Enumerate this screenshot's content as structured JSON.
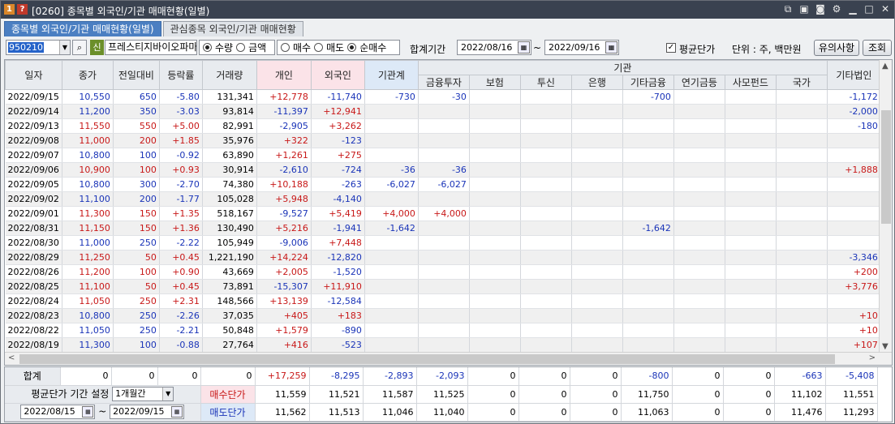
{
  "titlebar": {
    "badge1": "1",
    "badge2": "?",
    "title": "[0260] 종목별 외국인/기관 매매현황(일별)",
    "icons": [
      "link-icon",
      "save-icon",
      "camera-icon",
      "settings-icon",
      "minimize-icon",
      "maximize-icon",
      "close-icon"
    ]
  },
  "tabs": [
    {
      "label": "종목별 외국인/기관 매매현황(일별)",
      "active": true
    },
    {
      "label": "관심종목 외국인/기관 매매현황",
      "active": false
    }
  ],
  "toolbar": {
    "code": "950210",
    "shin": "신",
    "stock_name": "프레스티지바이오파마",
    "unit_type": {
      "options": [
        "수량",
        "금액"
      ],
      "selected": "수량"
    },
    "trade_type": {
      "options": [
        "매수",
        "매도",
        "순매수"
      ],
      "selected": "순매수"
    },
    "period_label": "합계기간",
    "start_date": "2022/08/16",
    "tilde": "~",
    "end_date": "2022/09/16",
    "avg_price_label": "평균단가",
    "avg_price_checked": true,
    "unit_label": "단위 : 주, 백만원",
    "notice_button": "유의사항",
    "query_button": "조회"
  },
  "grid": {
    "group_header": "기관",
    "headers": [
      "일자",
      "종가",
      "전일대비",
      "등락률",
      "거래량",
      "개인",
      "외국인",
      "기관계",
      "금융투자",
      "보험",
      "투신",
      "은행",
      "기타금융",
      "연기금등",
      "사모펀드",
      "국가",
      "기타법인"
    ],
    "rows": [
      {
        "date": "2022/09/15",
        "close": "10,550",
        "chg": "650",
        "rate": "-5.80",
        "vol": "131,341",
        "ind": "+12,778",
        "frn": "-11,740",
        "inst": "-730",
        "fin": "-30",
        "ins": "",
        "trust": "",
        "bank": "",
        "etcfin": "-700",
        "pens": "",
        "pef": "",
        "gov": "",
        "corp": "-1,172",
        "color": "blue",
        "alt": false
      },
      {
        "date": "2022/09/14",
        "close": "11,200",
        "chg": "350",
        "rate": "-3.03",
        "vol": "93,814",
        "ind": "-11,397",
        "frn": "+12,941",
        "inst": "",
        "fin": "",
        "ins": "",
        "trust": "",
        "bank": "",
        "etcfin": "",
        "pens": "",
        "pef": "",
        "gov": "",
        "corp": "-2,000",
        "color": "blue",
        "alt": true
      },
      {
        "date": "2022/09/13",
        "close": "11,550",
        "chg": "550",
        "rate": "+5.00",
        "vol": "82,991",
        "ind": "-2,905",
        "frn": "+3,262",
        "inst": "",
        "fin": "",
        "ins": "",
        "trust": "",
        "bank": "",
        "etcfin": "",
        "pens": "",
        "pef": "",
        "gov": "",
        "corp": "-180",
        "color": "red",
        "alt": false
      },
      {
        "date": "2022/09/08",
        "close": "11,000",
        "chg": "200",
        "rate": "+1.85",
        "vol": "35,976",
        "ind": "+322",
        "frn": "-123",
        "inst": "",
        "fin": "",
        "ins": "",
        "trust": "",
        "bank": "",
        "etcfin": "",
        "pens": "",
        "pef": "",
        "gov": "",
        "corp": "",
        "color": "red",
        "alt": true
      },
      {
        "date": "2022/09/07",
        "close": "10,800",
        "chg": "100",
        "rate": "-0.92",
        "vol": "63,890",
        "ind": "+1,261",
        "frn": "+275",
        "inst": "",
        "fin": "",
        "ins": "",
        "trust": "",
        "bank": "",
        "etcfin": "",
        "pens": "",
        "pef": "",
        "gov": "",
        "corp": "",
        "color": "blue",
        "alt": false
      },
      {
        "date": "2022/09/06",
        "close": "10,900",
        "chg": "100",
        "rate": "+0.93",
        "vol": "30,914",
        "ind": "-2,610",
        "frn": "-724",
        "inst": "-36",
        "fin": "-36",
        "ins": "",
        "trust": "",
        "bank": "",
        "etcfin": "",
        "pens": "",
        "pef": "",
        "gov": "",
        "corp": "+1,888",
        "color": "red",
        "alt": true
      },
      {
        "date": "2022/09/05",
        "close": "10,800",
        "chg": "300",
        "rate": "-2.70",
        "vol": "74,380",
        "ind": "+10,188",
        "frn": "-263",
        "inst": "-6,027",
        "fin": "-6,027",
        "ins": "",
        "trust": "",
        "bank": "",
        "etcfin": "",
        "pens": "",
        "pef": "",
        "gov": "",
        "corp": "",
        "color": "blue",
        "alt": false
      },
      {
        "date": "2022/09/02",
        "close": "11,100",
        "chg": "200",
        "rate": "-1.77",
        "vol": "105,028",
        "ind": "+5,948",
        "frn": "-4,140",
        "inst": "",
        "fin": "",
        "ins": "",
        "trust": "",
        "bank": "",
        "etcfin": "",
        "pens": "",
        "pef": "",
        "gov": "",
        "corp": "",
        "color": "blue",
        "alt": true
      },
      {
        "date": "2022/09/01",
        "close": "11,300",
        "chg": "150",
        "rate": "+1.35",
        "vol": "518,167",
        "ind": "-9,527",
        "frn": "+5,419",
        "inst": "+4,000",
        "fin": "+4,000",
        "ins": "",
        "trust": "",
        "bank": "",
        "etcfin": "",
        "pens": "",
        "pef": "",
        "gov": "",
        "corp": "",
        "color": "red",
        "alt": false
      },
      {
        "date": "2022/08/31",
        "close": "11,150",
        "chg": "150",
        "rate": "+1.36",
        "vol": "130,490",
        "ind": "+5,216",
        "frn": "-1,941",
        "inst": "-1,642",
        "fin": "",
        "ins": "",
        "trust": "",
        "bank": "",
        "etcfin": "-1,642",
        "pens": "",
        "pef": "",
        "gov": "",
        "corp": "",
        "color": "red",
        "alt": true
      },
      {
        "date": "2022/08/30",
        "close": "11,000",
        "chg": "250",
        "rate": "-2.22",
        "vol": "105,949",
        "ind": "-9,006",
        "frn": "+7,448",
        "inst": "",
        "fin": "",
        "ins": "",
        "trust": "",
        "bank": "",
        "etcfin": "",
        "pens": "",
        "pef": "",
        "gov": "",
        "corp": "",
        "color": "blue",
        "alt": false
      },
      {
        "date": "2022/08/29",
        "close": "11,250",
        "chg": "50",
        "rate": "+0.45",
        "vol": "1,221,190",
        "ind": "+14,224",
        "frn": "-12,820",
        "inst": "",
        "fin": "",
        "ins": "",
        "trust": "",
        "bank": "",
        "etcfin": "",
        "pens": "",
        "pef": "",
        "gov": "",
        "corp": "-3,346",
        "color": "red",
        "alt": true
      },
      {
        "date": "2022/08/26",
        "close": "11,200",
        "chg": "100",
        "rate": "+0.90",
        "vol": "43,669",
        "ind": "+2,005",
        "frn": "-1,520",
        "inst": "",
        "fin": "",
        "ins": "",
        "trust": "",
        "bank": "",
        "etcfin": "",
        "pens": "",
        "pef": "",
        "gov": "",
        "corp": "+200",
        "color": "red",
        "alt": false
      },
      {
        "date": "2022/08/25",
        "close": "11,100",
        "chg": "50",
        "rate": "+0.45",
        "vol": "73,891",
        "ind": "-15,307",
        "frn": "+11,910",
        "inst": "",
        "fin": "",
        "ins": "",
        "trust": "",
        "bank": "",
        "etcfin": "",
        "pens": "",
        "pef": "",
        "gov": "",
        "corp": "+3,776",
        "color": "red",
        "alt": true
      },
      {
        "date": "2022/08/24",
        "close": "11,050",
        "chg": "250",
        "rate": "+2.31",
        "vol": "148,566",
        "ind": "+13,139",
        "frn": "-12,584",
        "inst": "",
        "fin": "",
        "ins": "",
        "trust": "",
        "bank": "",
        "etcfin": "",
        "pens": "",
        "pef": "",
        "gov": "",
        "corp": "",
        "color": "red",
        "alt": false
      },
      {
        "date": "2022/08/23",
        "close": "10,800",
        "chg": "250",
        "rate": "-2.26",
        "vol": "37,035",
        "ind": "+405",
        "frn": "+183",
        "inst": "",
        "fin": "",
        "ins": "",
        "trust": "",
        "bank": "",
        "etcfin": "",
        "pens": "",
        "pef": "",
        "gov": "",
        "corp": "+10",
        "color": "blue",
        "alt": true
      },
      {
        "date": "2022/08/22",
        "close": "11,050",
        "chg": "250",
        "rate": "-2.21",
        "vol": "50,848",
        "ind": "+1,579",
        "frn": "-890",
        "inst": "",
        "fin": "",
        "ins": "",
        "trust": "",
        "bank": "",
        "etcfin": "",
        "pens": "",
        "pef": "",
        "gov": "",
        "corp": "+10",
        "color": "blue",
        "alt": false
      },
      {
        "date": "2022/08/19",
        "close": "11,300",
        "chg": "100",
        "rate": "-0.88",
        "vol": "27,764",
        "ind": "+416",
        "frn": "-523",
        "inst": "",
        "fin": "",
        "ins": "",
        "trust": "",
        "bank": "",
        "etcfin": "",
        "pens": "",
        "pef": "",
        "gov": "",
        "corp": "+107",
        "color": "blue",
        "alt": true
      }
    ]
  },
  "summary": {
    "total_label": "합계",
    "total": [
      "0",
      "0",
      "0",
      "0",
      "+17,259",
      "-8,295",
      "-2,893",
      "-2,093",
      "0",
      "0",
      "0",
      "-800",
      "0",
      "0",
      "-663",
      "-5,408"
    ],
    "period_label": "평균단가 기간 설정",
    "period_value": "1개월간",
    "start_date": "2022/08/15",
    "tilde": "~",
    "end_date": "2022/09/15",
    "buy_label": "매수단가",
    "buy": [
      "11,559",
      "11,521",
      "11,587",
      "11,525",
      "0",
      "0",
      "0",
      "11,750",
      "0",
      "0",
      "11,102",
      "11,551"
    ],
    "sell_label": "매도단가",
    "sell": [
      "11,562",
      "11,513",
      "11,046",
      "11,040",
      "0",
      "0",
      "0",
      "11,063",
      "0",
      "0",
      "11,476",
      "11,293"
    ]
  }
}
